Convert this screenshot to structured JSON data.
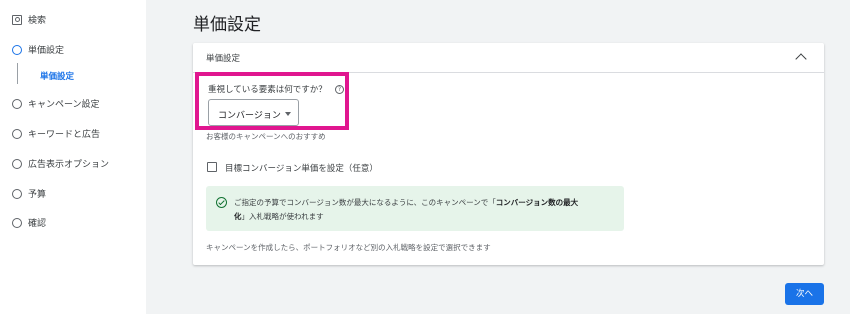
{
  "sidebar": {
    "search_label": "検索",
    "items": [
      {
        "label": "単価設定",
        "active": true
      },
      {
        "label": "キャンペーン設定"
      },
      {
        "label": "キーワードと広告"
      },
      {
        "label": "広告表示オプション"
      },
      {
        "label": "予算"
      },
      {
        "label": "確認"
      }
    ],
    "sub_item": "単価設定"
  },
  "page": {
    "title": "単価設定"
  },
  "card": {
    "header_title": "単価設定",
    "question": "重視している要素は何ですか？",
    "help_glyph": "?",
    "dropdown_value": "コンバージョン",
    "recommendation": "お客様のキャンペーンへのおすすめ",
    "checkbox_label": "目標コンバージョン単価を設定（任意）",
    "info": {
      "line1_prefix": "ご指定の予算でコンバージョン数が最大になるように、このキャンペーンで「",
      "line1_bold": "コンバージョン数の最大",
      "line2_bold": "化",
      "line2_suffix": "」入札戦略が使われます"
    },
    "footer_note": "キャンペーンを作成したら、ポートフォリオなど別の入札戦略を設定で選択できます"
  },
  "actions": {
    "next_label": "次へ"
  },
  "colors": {
    "accent": "#1a73e8",
    "highlight": "#e0168f",
    "info_bg": "#e6f4ea",
    "success": "#137333"
  }
}
